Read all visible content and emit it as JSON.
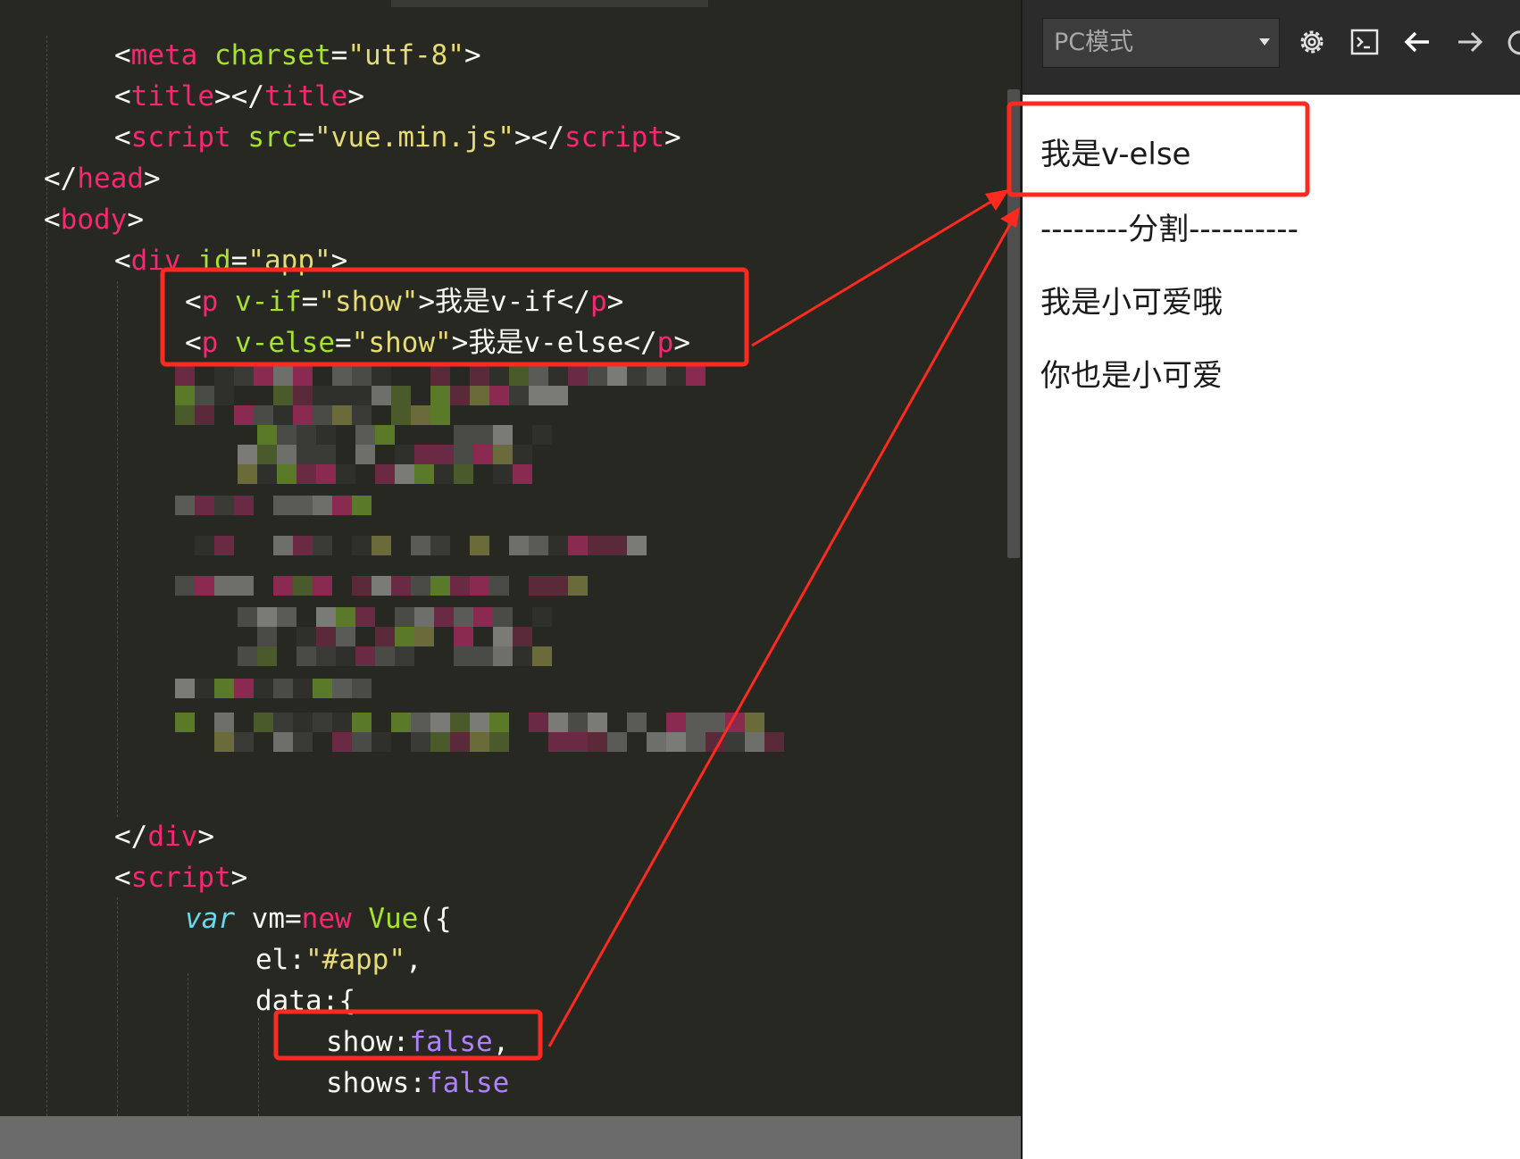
{
  "editor": {
    "lines": [
      [
        [
          "t",
          "<"
        ],
        [
          "g",
          "meta"
        ],
        [
          "t",
          " "
        ],
        [
          "a",
          "charset"
        ],
        [
          "t",
          "="
        ],
        [
          "s",
          "\"utf-8\""
        ],
        [
          "t",
          ">"
        ]
      ],
      [
        [
          "t",
          "<"
        ],
        [
          "g",
          "title"
        ],
        [
          "t",
          "></"
        ],
        [
          "g",
          "title"
        ],
        [
          "t",
          ">"
        ]
      ],
      [
        [
          "t",
          "<"
        ],
        [
          "g",
          "script"
        ],
        [
          "t",
          " "
        ],
        [
          "a",
          "src"
        ],
        [
          "t",
          "="
        ],
        [
          "s",
          "\"vue.min.js\""
        ],
        [
          "t",
          "></"
        ],
        [
          "g",
          "script"
        ],
        [
          "t",
          ">"
        ]
      ],
      [
        [
          "t",
          "</"
        ],
        [
          "g",
          "head"
        ],
        [
          "t",
          ">"
        ]
      ],
      [
        [
          "t",
          "<"
        ],
        [
          "g",
          "body"
        ],
        [
          "t",
          ">"
        ]
      ],
      [
        [
          "t",
          "<"
        ],
        [
          "g",
          "div"
        ],
        [
          "t",
          " "
        ],
        [
          "a",
          "id"
        ],
        [
          "t",
          "="
        ],
        [
          "s",
          "\"app\""
        ],
        [
          "t",
          ">"
        ]
      ],
      [
        [
          "t",
          "<"
        ],
        [
          "g",
          "p"
        ],
        [
          "t",
          " "
        ],
        [
          "a",
          "v-if"
        ],
        [
          "t",
          "="
        ],
        [
          "s",
          "\"show\""
        ],
        [
          "t",
          ">我是v-if</"
        ],
        [
          "g",
          "p"
        ],
        [
          "t",
          ">"
        ]
      ],
      [
        [
          "t",
          "<"
        ],
        [
          "g",
          "p"
        ],
        [
          "t",
          " "
        ],
        [
          "a",
          "v-else"
        ],
        [
          "t",
          "="
        ],
        [
          "s",
          "\"show\""
        ],
        [
          "t",
          ">我是v-else</"
        ],
        [
          "g",
          "p"
        ],
        [
          "t",
          ">"
        ]
      ],
      [
        [
          "t",
          "</"
        ],
        [
          "g",
          "div"
        ],
        [
          "t",
          ">"
        ]
      ],
      [
        [
          "t",
          "<"
        ],
        [
          "g",
          "script"
        ],
        [
          "t",
          ">"
        ]
      ],
      [
        [
          "v",
          "var"
        ],
        [
          "t",
          " vm="
        ],
        [
          "k",
          "new"
        ],
        [
          "t",
          " "
        ],
        [
          "c",
          "Vue"
        ],
        [
          "t",
          "({"
        ]
      ],
      [
        [
          "t",
          "el:"
        ],
        [
          "s",
          "\"#app\""
        ],
        [
          "t",
          ","
        ]
      ],
      [
        [
          "t",
          "data:{"
        ]
      ],
      [
        [
          "t",
          "show:"
        ],
        [
          "b",
          "false"
        ],
        [
          "t",
          ","
        ]
      ],
      [
        [
          "t",
          "shows:"
        ],
        [
          "b",
          "false"
        ]
      ]
    ]
  },
  "preview": {
    "toolbar": {
      "mode_label": "PC模式",
      "icons": [
        "gear-icon",
        "terminal-icon",
        "arrow-left-icon",
        "arrow-right-icon",
        "refresh-icon"
      ]
    },
    "texts": [
      "我是v-else",
      "--------分割----------",
      "我是小可爱哦",
      "你也是小可爱"
    ]
  },
  "annotations": {
    "color": "#ff2a1f"
  },
  "theme": {
    "editor_bg": "#272822",
    "tag": "#f92672",
    "attr": "#a6e22e",
    "string": "#e6db74",
    "boolean": "#ae81ff",
    "keyword_italic": "#66d9ef"
  }
}
